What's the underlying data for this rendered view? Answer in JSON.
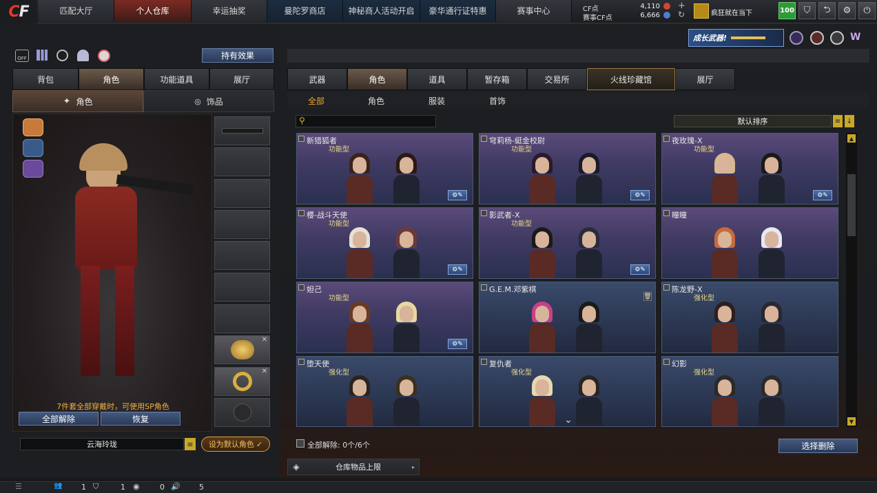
{
  "topnav": {
    "tabs": [
      "匹配大厅",
      "个人仓库",
      "幸运抽奖",
      "曼陀罗商店",
      "神秘商人活动开启",
      "豪华通行证特惠",
      "赛事中心"
    ],
    "active_index": 1
  },
  "currency": {
    "cf_label": "CF点",
    "cf_value": "4,110",
    "event_label": "赛事CF点",
    "event_value": "6,666"
  },
  "user": {
    "status": "疯狂就在当下",
    "level": "100"
  },
  "banner": {
    "text": "成长武器!"
  },
  "left": {
    "effect_button": "持有效果",
    "tabs": [
      "背包",
      "角色",
      "功能道具",
      "展厅"
    ],
    "active_tab": 1,
    "subtabs": [
      "角色",
      "饰品"
    ],
    "notice": "7件套全部穿戴时，可使用SP角色",
    "unequip_all": "全部解除",
    "restore": "恢复",
    "character_name": "云海玲珑",
    "set_default": "设为默认角色"
  },
  "right": {
    "tabs": [
      "武器",
      "角色",
      "道具",
      "暂存箱",
      "交易所",
      "火线珍藏馆",
      "展厅"
    ],
    "active_tab": 1,
    "highlight_tab": 5,
    "filters": [
      "全部",
      "角色",
      "服装",
      "首饰"
    ],
    "active_filter": 0,
    "sort": "默认排序",
    "search_placeholder": "",
    "cards": [
      {
        "name": "新猎狐者",
        "tag": "功能型",
        "style": "purple",
        "edit": true
      },
      {
        "name": "穹莉杨-綎金校尉",
        "tag": "功能型",
        "style": "purple",
        "edit": true
      },
      {
        "name": "夜玫瑰-X",
        "tag": "功能型",
        "style": "purple",
        "edit": true
      },
      {
        "name": "樱-战斗天使",
        "tag": "功能型",
        "style": "purple",
        "edit": true
      },
      {
        "name": "影武者-X",
        "tag": "功能型",
        "style": "purple",
        "edit": true
      },
      {
        "name": "瞳瞳",
        "tag": "",
        "style": "purple",
        "edit": false
      },
      {
        "name": "妲己",
        "tag": "功能型",
        "style": "purple",
        "edit": true
      },
      {
        "name": "G.E.M.邓紫棋",
        "tag": "",
        "style": "blue",
        "edit": false
      },
      {
        "name": "陈龙野-X",
        "tag": "强化型",
        "style": "blue",
        "edit": false
      },
      {
        "name": "堕天使",
        "tag": "强化型",
        "style": "blue",
        "edit": false
      },
      {
        "name": "复仇者",
        "tag": "强化型",
        "style": "blue",
        "edit": false
      },
      {
        "name": "幻影",
        "tag": "强化型",
        "style": "blue",
        "edit": false
      }
    ],
    "unequip_count": "全部解除: 0个/6个",
    "select_delete": "选择删除",
    "warehouse_limit": "仓库物品上限"
  },
  "bottom": {
    "values": [
      "1",
      "1",
      "0",
      "5"
    ]
  }
}
